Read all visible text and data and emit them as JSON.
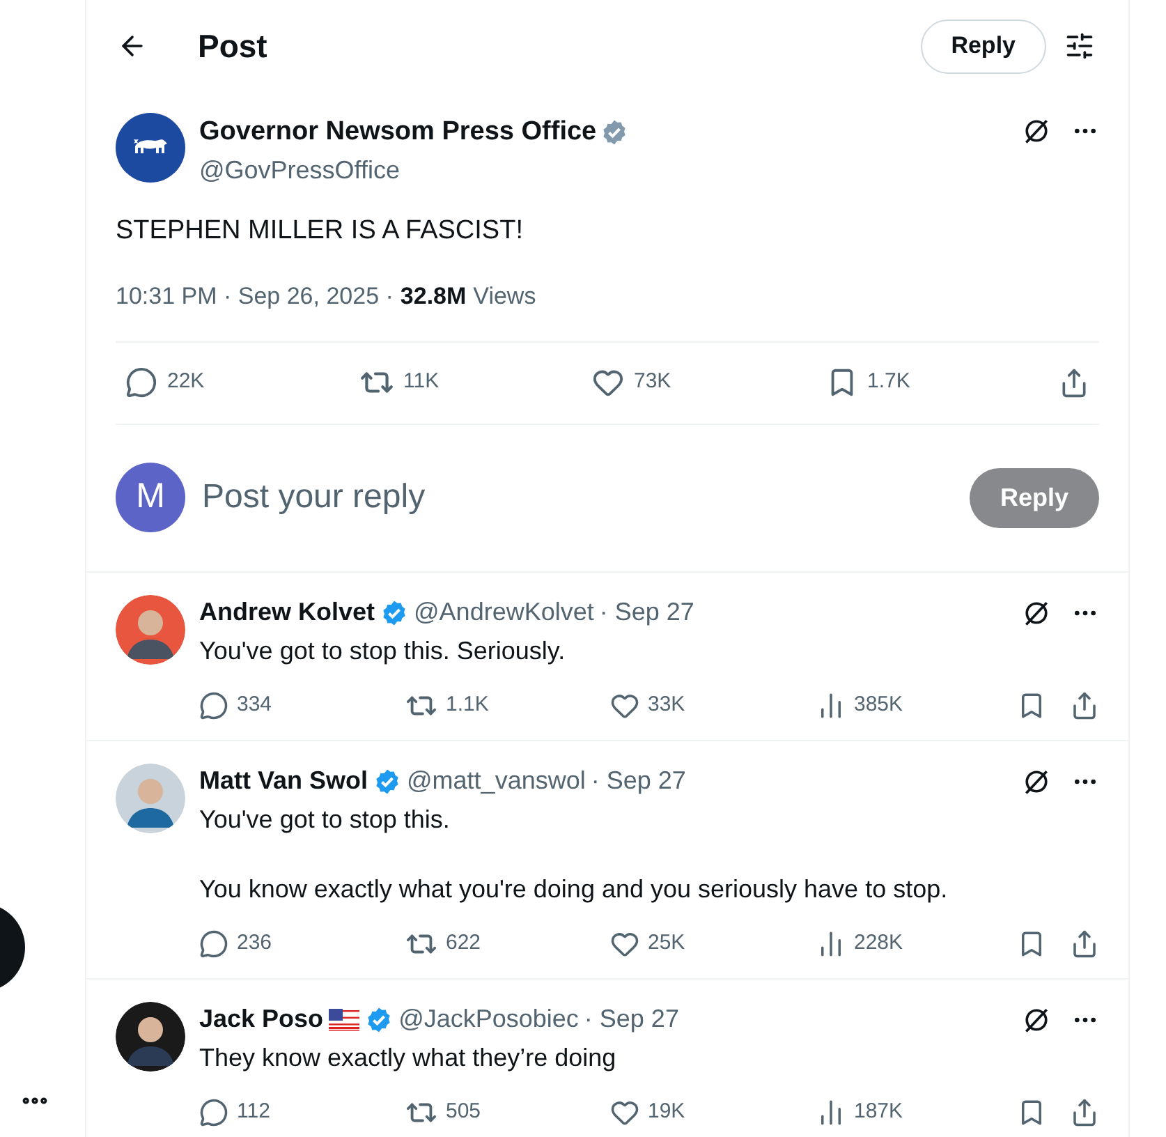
{
  "header": {
    "title": "Post",
    "reply_button": "Reply"
  },
  "post": {
    "name": "Governor Newsom Press Office",
    "handle": "@GovPressOffice",
    "badge": {
      "color": "#829aab"
    },
    "text": "STEPHEN MILLER IS A FASCIST!",
    "meta": "10:31 PM · Sep 26, 2025 ·",
    "views_count": "32.8M",
    "views_label": "Views",
    "replies": "22K",
    "reposts": "11K",
    "likes": "73K",
    "bookmarks": "1.7K"
  },
  "composer": {
    "avatar_letter": "M",
    "placeholder": "Post your reply",
    "button": "Reply",
    "disabled": true
  },
  "replies": [
    {
      "name": "Andrew Kolvet",
      "flag": false,
      "badge": {
        "color": "#1d9bf0"
      },
      "handle": "@AndrewKolvet",
      "date": "· Sep 27",
      "paragraphs": [
        "You've got to stop this. Seriously."
      ],
      "replies": "334",
      "reposts": "1.1K",
      "likes": "33K",
      "views": "385K"
    },
    {
      "name": "Matt Van Swol",
      "flag": false,
      "badge": {
        "color": "#1d9bf0"
      },
      "handle": "@matt_vanswol",
      "date": "· Sep 27",
      "paragraphs": [
        "You've got to stop this.",
        "You know exactly what you're doing and you seriously have to stop."
      ],
      "replies": "236",
      "reposts": "622",
      "likes": "25K",
      "views": "228K"
    },
    {
      "name": "Jack Poso",
      "flag": true,
      "badge": {
        "color": "#1d9bf0"
      },
      "handle": "@JackPosobiec",
      "date": "· Sep 27",
      "paragraphs": [
        "They know exactly what they’re doing"
      ],
      "replies": "112",
      "reposts": "505",
      "likes": "19K",
      "views": "187K"
    }
  ]
}
